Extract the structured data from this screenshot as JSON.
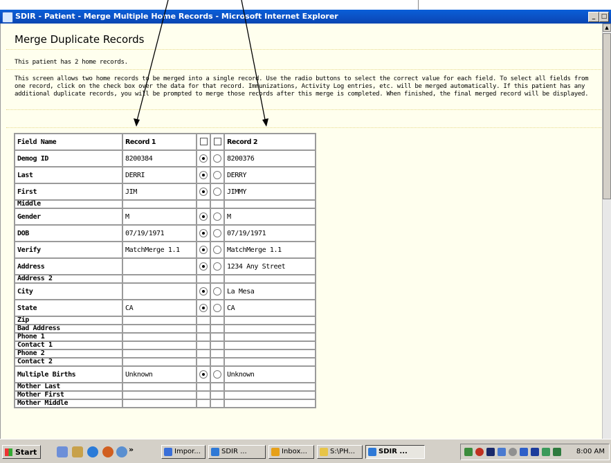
{
  "window": {
    "title": "SDIR - Patient - Merge Multiple Home Records - Microsoft Internet Explorer",
    "min_label": "_",
    "max_label": "□"
  },
  "page": {
    "title": "Merge Duplicate Records",
    "subtitle": "This patient has 2 home records.",
    "instructions": "This screen allows two home records to be merged into a single record. Use the radio buttons to select the correct value for each field. To select all fields from one record, click on the check box over the data for that record. Immunizations, Activity Log entries, etc. will be merged automatically. If this patient has any additional duplicate records, you will be prompted to merge those records after this merge is completed. When finished, the final merged record will be displayed."
  },
  "table": {
    "headers": {
      "field": "Field Name",
      "record1": "Record 1",
      "record2": "Record 2"
    },
    "rows": [
      {
        "field": "Demog ID",
        "r1": "8200384",
        "r2": "8200376",
        "radio": true,
        "selected": 1
      },
      {
        "field": "Last",
        "r1": "DERRI",
        "r2": "DERRY",
        "radio": true,
        "selected": 1
      },
      {
        "field": "First",
        "r1": "JIM",
        "r2": "JIMMY",
        "radio": true,
        "selected": 1
      },
      {
        "field": "Middle",
        "r1": "",
        "r2": "",
        "radio": false
      },
      {
        "field": "Gender",
        "r1": "M",
        "r2": "M",
        "radio": true,
        "selected": 1
      },
      {
        "field": "DOB",
        "r1": "07/19/1971",
        "r2": "07/19/1971",
        "radio": true,
        "selected": 1
      },
      {
        "field": "Verify",
        "r1": "MatchMerge 1.1",
        "r2": "MatchMerge 1.1",
        "radio": true,
        "selected": 1
      },
      {
        "field": "Address",
        "r1": "",
        "r2": "1234 Any Street",
        "radio": true,
        "selected": 1
      },
      {
        "field": "Address 2",
        "r1": "",
        "r2": "",
        "radio": false
      },
      {
        "field": "City",
        "r1": "",
        "r2": "La Mesa",
        "radio": true,
        "selected": 1
      },
      {
        "field": "State",
        "r1": "CA",
        "r2": "CA",
        "radio": true,
        "selected": 1
      },
      {
        "field": "Zip",
        "r1": "",
        "r2": "",
        "radio": false
      },
      {
        "field": "Bad Address",
        "r1": "",
        "r2": "",
        "radio": false
      },
      {
        "field": "Phone 1",
        "r1": "",
        "r2": "",
        "radio": false
      },
      {
        "field": "Contact 1",
        "r1": "",
        "r2": "",
        "radio": false
      },
      {
        "field": "Phone 2",
        "r1": "",
        "r2": "",
        "radio": false
      },
      {
        "field": "Contact 2",
        "r1": "",
        "r2": "",
        "radio": false
      },
      {
        "field": "Multiple Births",
        "r1": "Unknown",
        "r2": "Unknown",
        "radio": true,
        "selected": 1
      },
      {
        "field": "Mother Last",
        "r1": "",
        "r2": "",
        "radio": false
      },
      {
        "field": "Mother First",
        "r1": "",
        "r2": "",
        "radio": false
      },
      {
        "field": "Mother Middle",
        "r1": "",
        "r2": "",
        "radio": false
      }
    ]
  },
  "taskbar": {
    "start_label": "Start",
    "more_label": "»",
    "buttons": [
      {
        "label": "Impor...",
        "active": false,
        "color": "#3a6fd8"
      },
      {
        "label": "SDIR ...",
        "active": false,
        "color": "#2f79d6"
      },
      {
        "label": "Inbox...",
        "active": false,
        "color": "#e6a019"
      },
      {
        "label": "S:\\PH...",
        "active": false,
        "color": "#e7c448"
      },
      {
        "label": "SDIR ...",
        "active": true,
        "color": "#2f79d6"
      }
    ],
    "clock": "8:00 AM"
  }
}
